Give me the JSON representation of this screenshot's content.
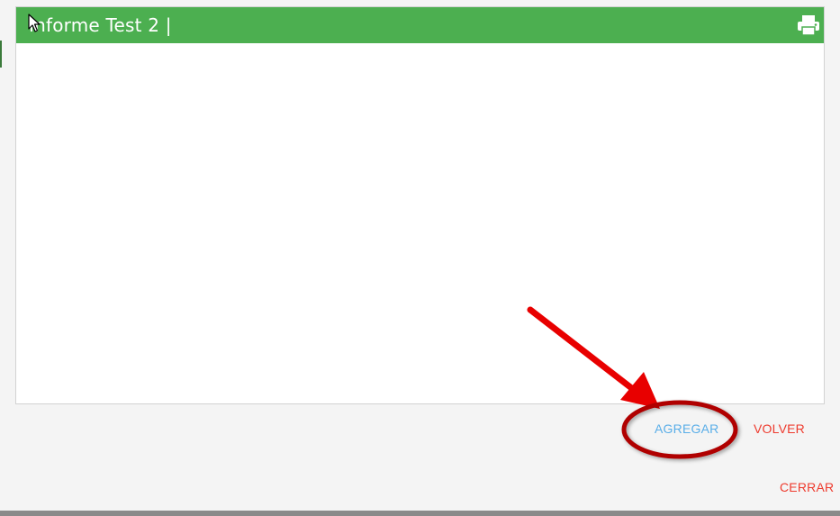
{
  "panel": {
    "title": "Informe Test 2 |",
    "print_icon": "print-icon"
  },
  "actions": {
    "agregar": "AGREGAR",
    "volver": "VOLVER",
    "cerrar": "CERRAR"
  },
  "colors": {
    "header": "#4caf50",
    "agregar": "#5aaee8",
    "volver_cerrar": "#ee3b2e",
    "annotation": "#e00000"
  }
}
